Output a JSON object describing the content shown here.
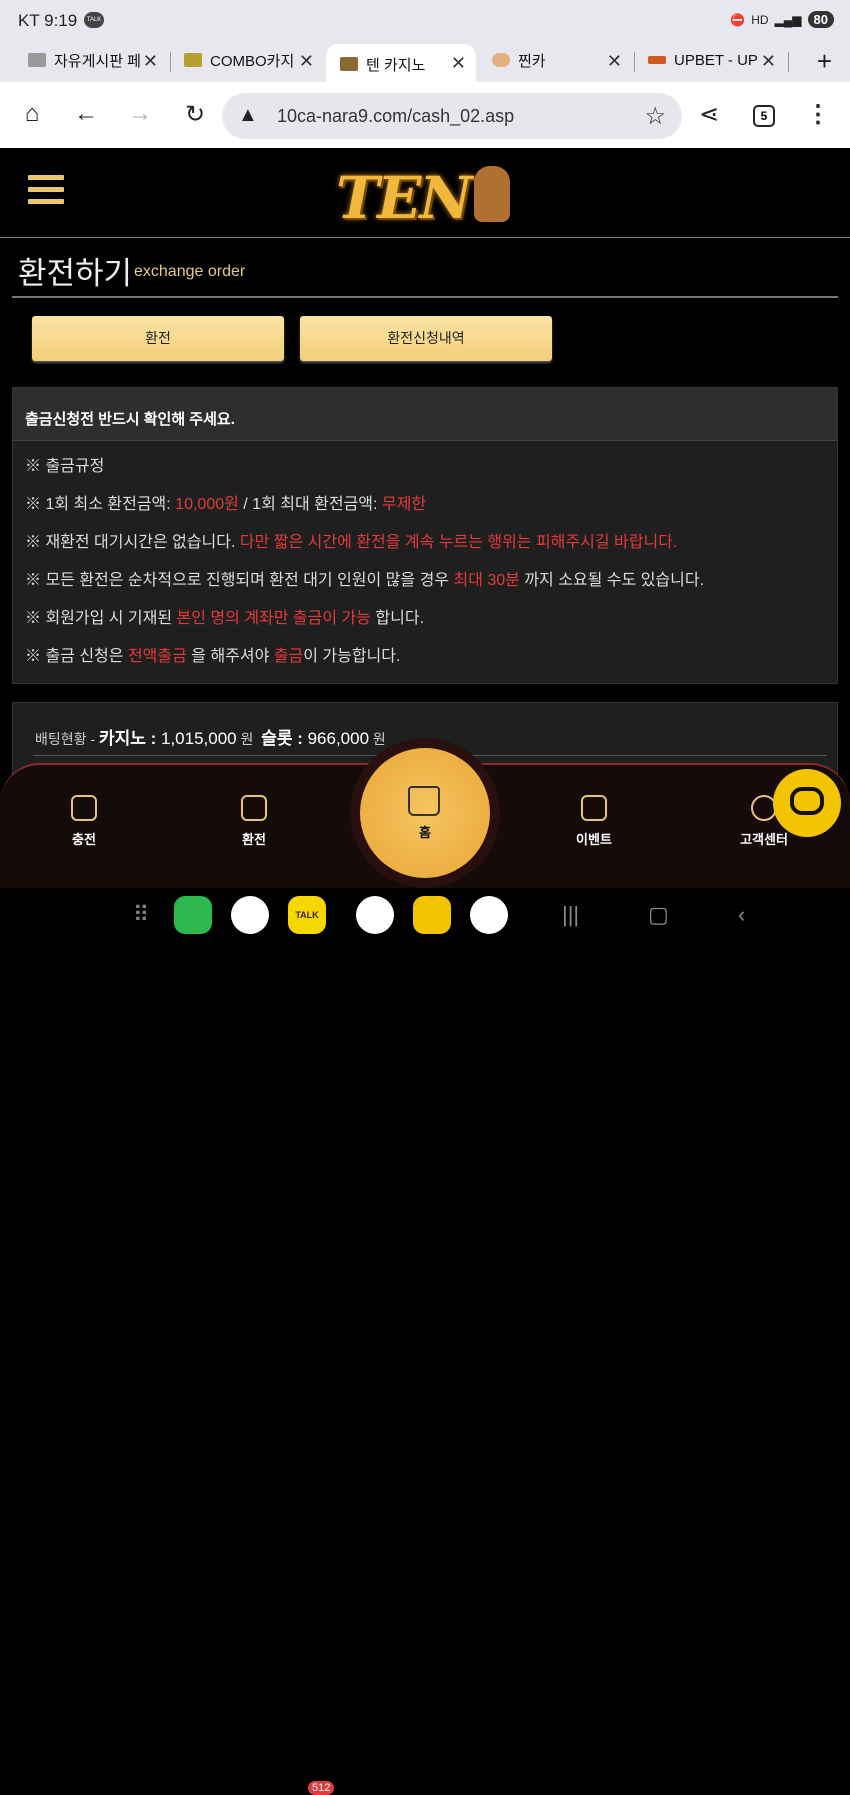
{
  "status_bar": {
    "carrier_time": "KT 9:19",
    "talk_label": "TALK",
    "battery": "80"
  },
  "tabs": [
    {
      "label": "자유게시판 페"
    },
    {
      "label": "COMBO카지"
    },
    {
      "label": "텐 카지노"
    },
    {
      "label": "찐카"
    },
    {
      "label": "UPBET - UP"
    }
  ],
  "address_bar": {
    "url": "10ca-nara9.com/cash_02.asp",
    "tab_count": "5"
  },
  "site": {
    "logo_text": "TEN"
  },
  "page": {
    "title": "환전하기",
    "subtitle": "exchange order",
    "buttons": {
      "exchange": "환전",
      "history": "환전신청내역"
    }
  },
  "notice": {
    "heading": "출금신청전 반드시 확인해 주세요.",
    "line1": "※ 출금규정",
    "line2": {
      "a": "※ 1회 최소 환전금액: ",
      "b": "10,000원",
      "c": " / 1회 최대 환전금액: ",
      "d": "무제한"
    },
    "line3": {
      "a": "※ 재환전 대기시간은 없습니다. ",
      "b": "다만 짧은 시간에 환전을 계속 누르는 행위는 피해주시길 바랍니다."
    },
    "line4": {
      "a": "※ 모든 환전은 순차적으로 진행되며 환전 대기 인원이 많을 경우 ",
      "b": "최대 30분",
      "c": " 까지 소요될 수도 있습니다."
    },
    "line5": {
      "a": "※ 회원가입 시 기재된 ",
      "b": "본인 명의 계좌만 출금이 가능",
      "c": " 합니다."
    },
    "line6": {
      "a": "※ 출금 신청은 ",
      "b": "전액출금",
      "c": " 을 해주셔야 ",
      "d": "출금",
      "e": "이 가능합니다."
    }
  },
  "betting": {
    "label": "배팅현황 - ",
    "casino_label": "카지노 : ",
    "casino_value": "1,015,000",
    "casino_unit": " 원",
    "slot_label": "슬롯 : ",
    "slot_value": "966,000",
    "slot_unit": " 원"
  },
  "bottom_nav": {
    "deposit": "충전",
    "exchange": "환전",
    "home": "홈",
    "event": "이벤트",
    "support": "고객센터"
  },
  "dock": {
    "kakao_badge": "512",
    "kakao_label": "TALK"
  },
  "colors": {
    "gold": "#f0b83c",
    "accent_red": "#e23a3a",
    "button_gold": "#f3cf7c"
  }
}
